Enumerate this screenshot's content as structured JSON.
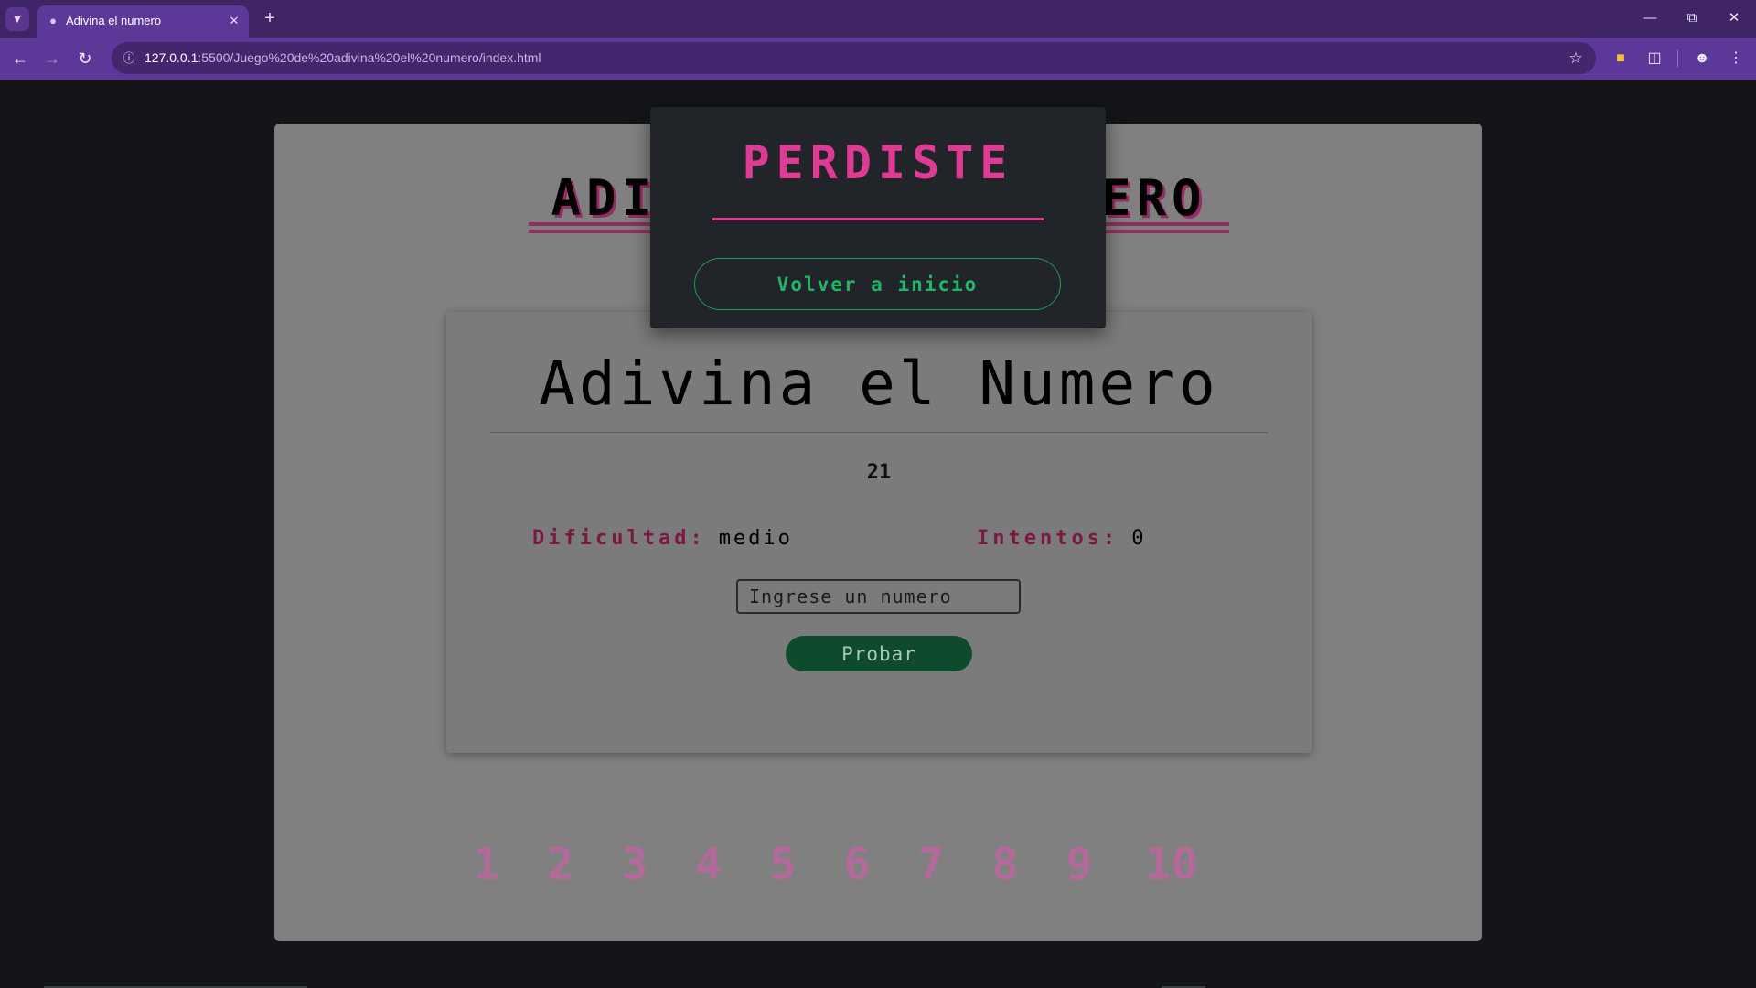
{
  "browser": {
    "tab_title": "Adivina el numero",
    "url_host": "127.0.0.1",
    "url_rest": ":5500/Juego%20de%20adivina%20el%20numero/index.html"
  },
  "page": {
    "title_left": "ADI",
    "title_right": "ERO",
    "card": {
      "title": "Adivina el Numero",
      "secret_number": "21",
      "difficulty_label": "Dificultad:",
      "difficulty_value": "medio",
      "attempts_label": "Intentos:",
      "attempts_value": "0",
      "input_placeholder": "Ingrese un numero",
      "try_button": "Probar"
    },
    "numbers": [
      "1",
      "2",
      "3",
      "4",
      "5",
      "6",
      "7",
      "8",
      "9",
      "10"
    ]
  },
  "modal": {
    "title": "PERDISTE",
    "home_button": "Volver a inicio"
  },
  "colors": {
    "chrome_purple": "#5c3898",
    "modal_title": "#de3c94",
    "home_button": "#22b566",
    "try_button_bg": "#0d4b2c",
    "numbers": "#b36a9a"
  },
  "icons": {
    "tab_search": "chevron-down-icon",
    "tab_favicon": "incognito-icon",
    "tab_close": "close-icon",
    "new_tab": "plus-icon",
    "back": "arrow-left-icon",
    "forward": "arrow-right-icon",
    "reload": "reload-icon",
    "site_info": "info-icon",
    "bookmark": "star-icon",
    "extension_1": "note-icon",
    "extensions": "puzzle-icon",
    "profile": "person-icon",
    "menu": "kebab-icon"
  }
}
